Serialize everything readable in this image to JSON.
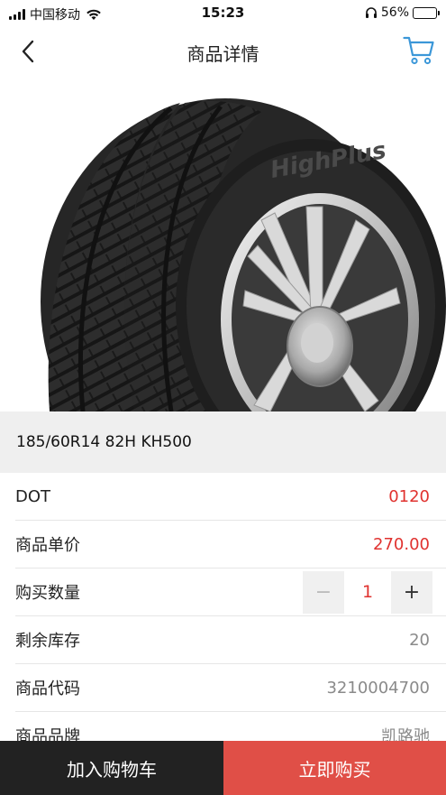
{
  "status_bar": {
    "carrier": "中国移动",
    "time": "15:23",
    "battery_percent": "56%",
    "battery_level": 0.56
  },
  "nav": {
    "title": "商品详情",
    "back_icon": "chevron-left-icon",
    "cart_icon": "shopping-cart-icon",
    "accent_color": "#3b97d8"
  },
  "product": {
    "name": "185/60R14 82H KH500",
    "image_icon": "tire-image",
    "image_brand_text": "HighPlus"
  },
  "info": {
    "dot_label": "DOT",
    "dot_value": "0120",
    "price_label": "商品单价",
    "price_value": "270.00",
    "quantity_label": "购买数量",
    "quantity_minus": "−",
    "quantity_value": "1",
    "quantity_plus": "+",
    "stock_label": "剩余库存",
    "stock_value": "20",
    "code_label": "商品代码",
    "code_value": "3210004700",
    "brand_label": "商品品牌",
    "brand_value": "凯路驰"
  },
  "actions": {
    "add_to_cart": "加入购物车",
    "buy_now": "立即购买"
  },
  "colors": {
    "price_red": "#e0322f",
    "buy_button": "#e04f47",
    "cart_button": "#222222"
  }
}
